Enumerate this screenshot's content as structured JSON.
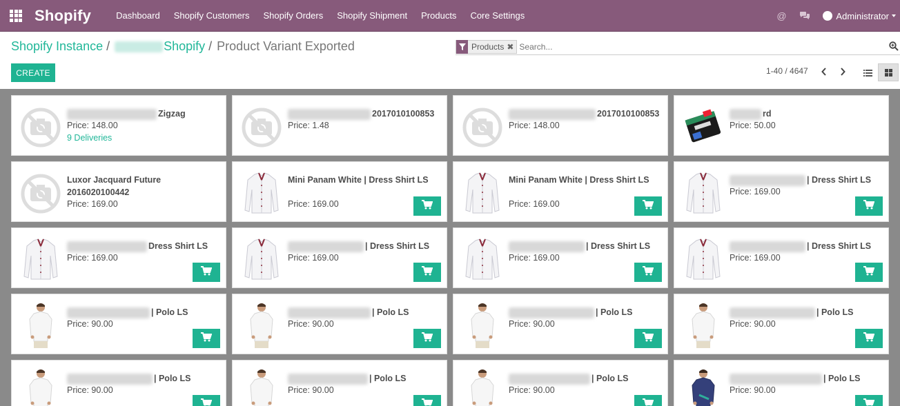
{
  "navbar": {
    "brand": "Shopify",
    "menu": [
      "Dashboard",
      "Shopify Customers",
      "Shopify Orders",
      "Shopify Shipment",
      "Products",
      "Core Settings"
    ],
    "user": "Administrator",
    "accent_color": "#875a7b"
  },
  "breadcrumb": {
    "first": "Shopify Instance",
    "second_suffix": "Shopify",
    "separator": "/",
    "current": "Product Variant Exported"
  },
  "search": {
    "facet_label": "Products",
    "placeholder": "Search..."
  },
  "actions": {
    "create_label": "CREATE"
  },
  "pager": {
    "text": "1-40 / 4647"
  },
  "cards": [
    {
      "title_suffix": "Zigzag",
      "price": "Price: 148.00",
      "deliveries": "9 Deliveries",
      "image": "no-image",
      "cart": false
    },
    {
      "title_suffix": "2017010100853",
      "price": "Price: 1.48",
      "image": "no-image",
      "cart": false
    },
    {
      "title_suffix": "2017010100853",
      "price": "Price: 148.00",
      "image": "no-image",
      "cart": false
    },
    {
      "title_suffix": "rd",
      "price": "Price: 50.00",
      "image": "gift-card",
      "cart": false
    },
    {
      "title": "Luxor Jacquard Future 2016020100442",
      "price": "Price: 169.00",
      "image": "no-image",
      "cart": false
    },
    {
      "title": "Mini Panam White | Dress Shirt LS",
      "price": "Price: 169.00",
      "image": "dress-shirt",
      "cart": true
    },
    {
      "title": "Mini Panam White | Dress Shirt LS",
      "price": "Price: 169.00",
      "image": "dress-shirt",
      "cart": true
    },
    {
      "title_suffix": "| Dress Shirt LS",
      "price": "Price: 169.00",
      "image": "dress-shirt",
      "cart": true
    },
    {
      "title_suffix": "Dress Shirt LS",
      "price": "Price: 169.00",
      "image": "dress-shirt",
      "cart": true
    },
    {
      "title_suffix": "| Dress Shirt LS",
      "price": "Price: 169.00",
      "image": "dress-shirt",
      "cart": true
    },
    {
      "title_suffix": "| Dress Shirt LS",
      "price": "Price: 169.00",
      "image": "dress-shirt",
      "cart": true
    },
    {
      "title_suffix": "| Dress Shirt LS",
      "price": "Price: 169.00",
      "image": "dress-shirt",
      "cart": true
    },
    {
      "title_suffix": "| Polo LS",
      "price": "Price: 90.00",
      "image": "polo-model",
      "cart": true
    },
    {
      "title_suffix": "| Polo LS",
      "price": "Price: 90.00",
      "image": "polo-model",
      "cart": true
    },
    {
      "title_suffix": "| Polo LS",
      "price": "Price: 90.00",
      "image": "polo-model",
      "cart": true
    },
    {
      "title_suffix": "| Polo LS",
      "price": "Price: 90.00",
      "image": "polo-model",
      "cart": true
    },
    {
      "title_suffix": "| Polo LS",
      "price": "Price: 90.00",
      "image": "polo-model",
      "cart": true
    },
    {
      "title_suffix": "| Polo LS",
      "price": "Price: 90.00",
      "image": "polo-model",
      "cart": true
    },
    {
      "title_suffix": "| Polo LS",
      "price": "Price: 90.00",
      "image": "polo-model",
      "cart": true
    },
    {
      "title_suffix": "| Polo LS",
      "price": "Price: 90.00",
      "image": "polo-model-blue",
      "cart": true
    }
  ]
}
